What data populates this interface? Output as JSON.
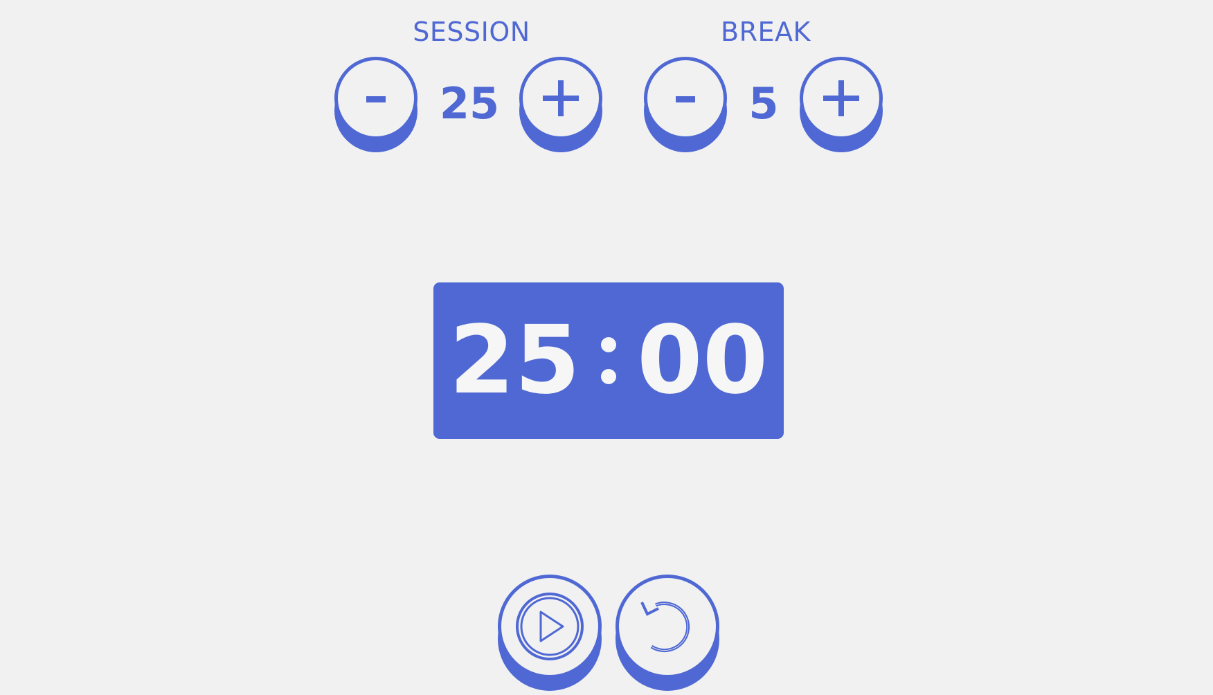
{
  "session": {
    "label": "SESSION",
    "value": "25",
    "decrement_label": "-",
    "increment_label": "+"
  },
  "break": {
    "label": "BREAK",
    "value": "5",
    "decrement_label": "-",
    "increment_label": "+"
  },
  "timer": {
    "minutes": "25",
    "seconds": "00"
  },
  "controls": {
    "play_icon": "play-circle-icon",
    "reset_icon": "reset-icon"
  },
  "colors": {
    "accent": "#4f68d4",
    "background": "#f1f1f1",
    "timer_text": "#f6f6f6"
  }
}
